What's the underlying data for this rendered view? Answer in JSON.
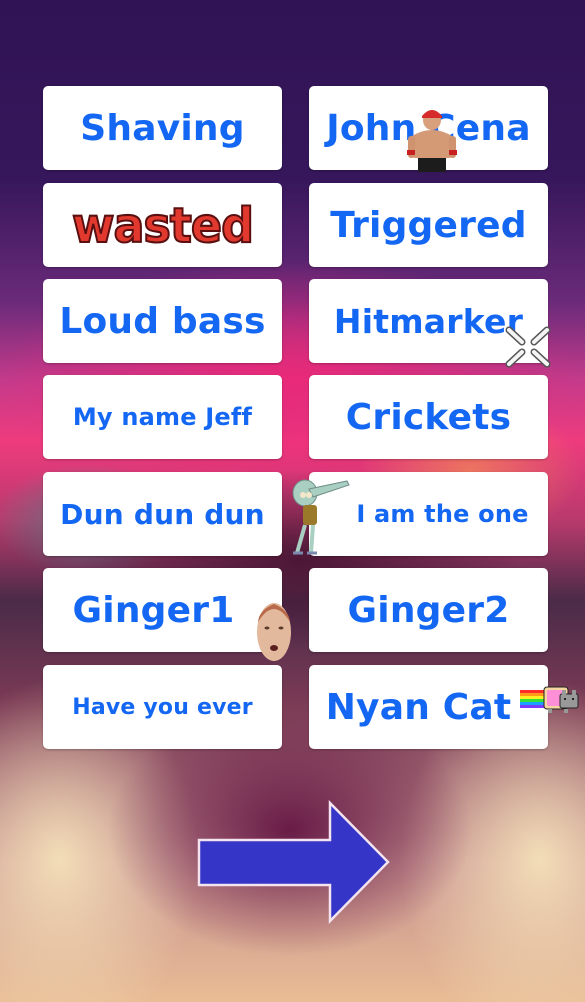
{
  "soundboard": {
    "buttons": [
      {
        "label": "Shaving"
      },
      {
        "label": "John Cena"
      },
      {
        "label": "wasted"
      },
      {
        "label": "Triggered"
      },
      {
        "label": "Loud bass"
      },
      {
        "label": "Hitmarker"
      },
      {
        "label": "My name Jeff"
      },
      {
        "label": "Crickets"
      },
      {
        "label": "Dun dun dun"
      },
      {
        "label": "I am the one"
      },
      {
        "label": "Ginger1"
      },
      {
        "label": "Ginger2"
      },
      {
        "label": "Have you ever"
      },
      {
        "label": "Nyan Cat"
      }
    ],
    "stickers": {
      "john_cena": "john-cena-figure",
      "hitmarker": "hitmarker-crosshair",
      "squidward": "squidward-dab",
      "ginger_face": "ginger-face",
      "nyan_cat": "nyan-cat"
    }
  },
  "navigation": {
    "next_icon": "right-arrow"
  },
  "colors": {
    "label_blue": "#1467f2",
    "wasted_red": "#e2392f",
    "arrow_blue": "#3535c8",
    "button_bg": "#ffffff"
  }
}
